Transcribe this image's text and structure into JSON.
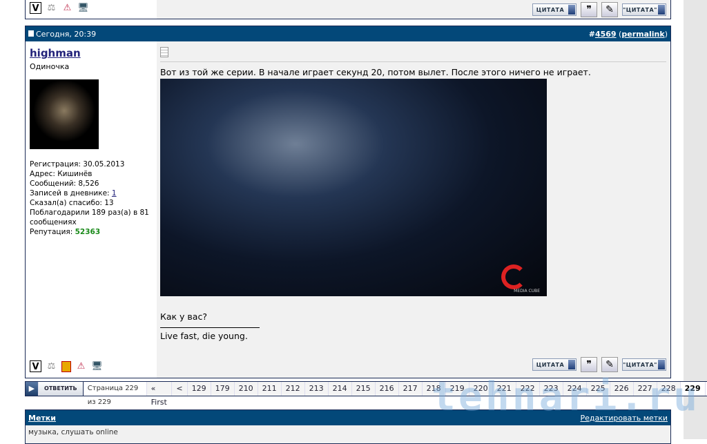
{
  "post": {
    "date": "Сегодня, 20:39",
    "number_prefix": "#",
    "number": "4569",
    "permalink": "permalink",
    "user": {
      "name": "highman",
      "title": "Одиночка",
      "stats": [
        {
          "label": "Регистрация: ",
          "value": "30.05.2013"
        },
        {
          "label": "Адрес: ",
          "value": "Кишинёв"
        },
        {
          "label": "Сообщений: ",
          "value": "8,526"
        },
        {
          "label": "Записей в дневнике: ",
          "value": "1"
        },
        {
          "label": "Сказал(а) спасибо: ",
          "value": "13"
        },
        {
          "label": "Поблагодарили 189 раз(а) в 81 сообщениях",
          "value": ""
        },
        {
          "label": "Репутация: ",
          "value": "52363"
        }
      ]
    },
    "text": "Вот из той же серии. В начале играет секунд 20, потом вылет. После этого ничего не играет.",
    "video_logo": "MEDIA CUBE",
    "question": "Как у вас?",
    "signature": "Live fast, die young."
  },
  "buttons": {
    "quote": "ЦИТАТА",
    "multiquote": "\"ЦИТАТА\""
  },
  "reply_label": "ОТВЕТИТЬ",
  "pagination": {
    "info": "Страница 229 из 229",
    "first": "« First",
    "prev": "<",
    "pages": [
      "129",
      "179",
      "210",
      "211",
      "212",
      "213",
      "214",
      "215",
      "216",
      "217",
      "218",
      "219",
      "220",
      "221",
      "222",
      "223",
      "224",
      "225",
      "226",
      "227",
      "228"
    ],
    "current": "229"
  },
  "tags": {
    "title": "Метки",
    "edit": "Редактировать метки",
    "list": "музыка, слушать online"
  },
  "watermark": "tehnari.ru",
  "colors": {
    "header": "#034879",
    "reputation": "#1a8a1a",
    "link": "#22227a"
  }
}
